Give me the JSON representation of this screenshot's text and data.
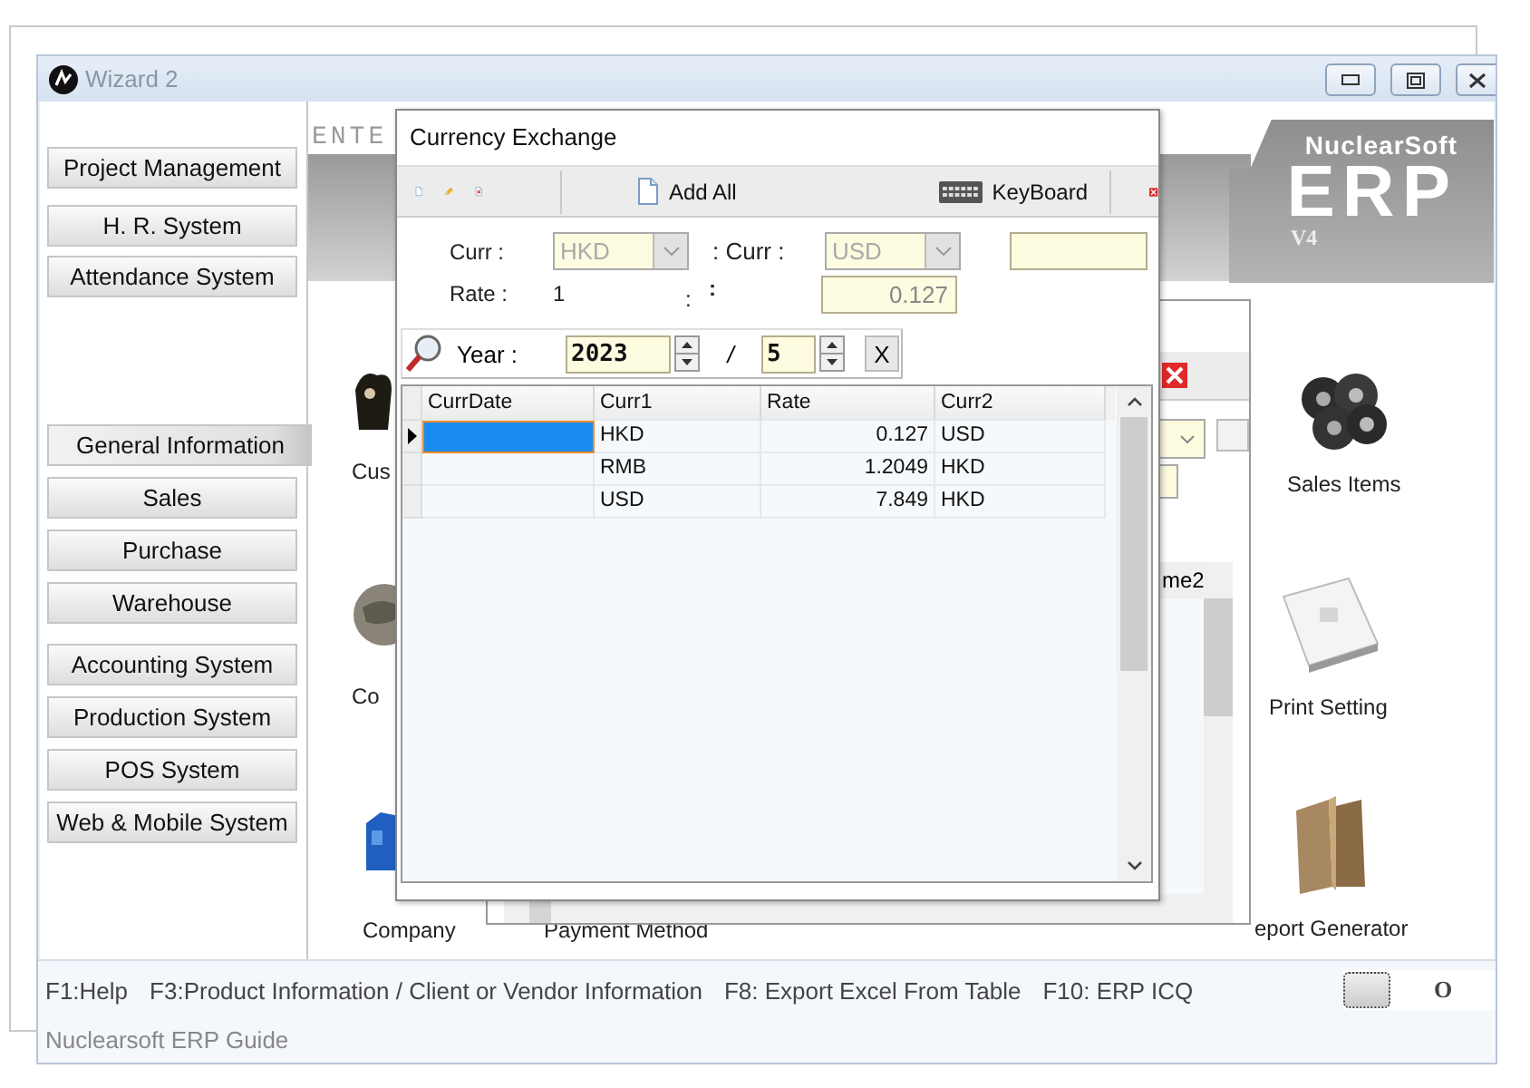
{
  "window": {
    "title": "Wizard 2"
  },
  "sidebar": {
    "groups": [
      [
        {
          "label": "Project Management",
          "selected": false
        }
      ],
      [
        {
          "label": "H. R. System",
          "selected": false
        },
        {
          "label": "Attendance System",
          "selected": false
        }
      ],
      [
        {
          "label": "General Information",
          "selected": true
        },
        {
          "label": "Sales",
          "selected": false
        },
        {
          "label": "Purchase",
          "selected": false
        },
        {
          "label": "Warehouse",
          "selected": false
        }
      ],
      [
        {
          "label": "Accounting System",
          "selected": false
        },
        {
          "label": "Production System",
          "selected": false
        },
        {
          "label": "POS System",
          "selected": false
        },
        {
          "label": "Web & Mobile System",
          "selected": false
        }
      ]
    ]
  },
  "banner": {
    "heading": "ENTE",
    "brand": "NuclearSoft",
    "product": "ERP",
    "version": "V4"
  },
  "tiles": [
    {
      "label": "Cus"
    },
    {
      "label": "Co"
    },
    {
      "label": "Company"
    },
    {
      "label": "Payment Method"
    },
    {
      "label": "Sales Items"
    },
    {
      "label": "Print Setting"
    },
    {
      "label": "eport Generator"
    }
  ],
  "back_dialog": {
    "column_header": "me2"
  },
  "dialog": {
    "title": "Currency Exchange",
    "toolbar": {
      "add_all": "Add All",
      "keyboard": "KeyBoard"
    },
    "form": {
      "curr_label": "Curr :",
      "curr": "HKD",
      "curr2_label": ": Curr :",
      "curr2": "USD",
      "rate_label": "Rate :",
      "rate": "1",
      "rate_sep": ":",
      "rate_sep2": ":",
      "rate2": "0.127"
    },
    "period": {
      "year_label": "Year :",
      "year": "2023",
      "separator": "/",
      "month": "5",
      "clear": "X"
    },
    "grid": {
      "columns": [
        "CurrDate",
        "Curr1",
        "Rate",
        "Curr2"
      ],
      "rows": [
        {
          "curr1": "HKD",
          "rate": "0.127",
          "curr2": "USD",
          "selected": true
        },
        {
          "curr1": "RMB",
          "rate": "1.2049",
          "curr2": "HKD",
          "selected": false
        },
        {
          "curr1": "USD",
          "rate": "7.849",
          "curr2": "HKD",
          "selected": false
        }
      ]
    }
  },
  "status_bar": {
    "shortcuts": [
      "F1:Help",
      "F3:Product Information / Client or Vendor Information",
      "F8: Export Excel From Table",
      "F10: ERP ICQ"
    ],
    "indicator": "O"
  },
  "guide": "Nuclearsoft ERP Guide"
}
